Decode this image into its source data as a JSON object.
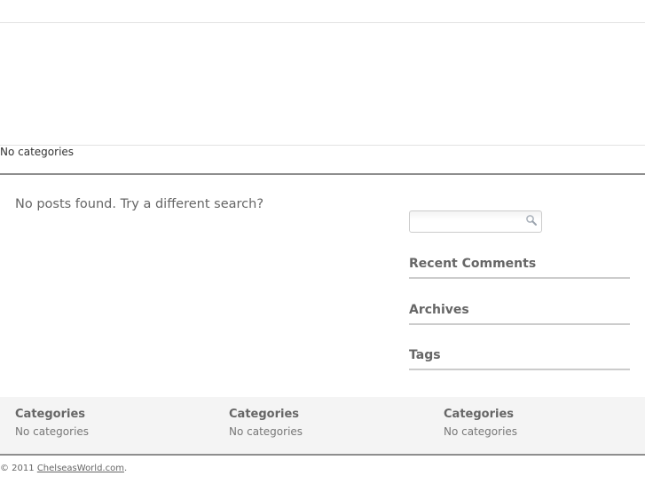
{
  "nav": {
    "text": "No categories"
  },
  "main": {
    "no_posts_message": "No posts found. Try a different search?"
  },
  "sidebar": {
    "search_placeholder": "",
    "widgets": [
      {
        "title": "Recent Comments"
      },
      {
        "title": "Archives"
      },
      {
        "title": "Tags"
      }
    ]
  },
  "footer_widgets": [
    {
      "title": "Categories",
      "text": "No categories"
    },
    {
      "title": "Categories",
      "text": "No categories"
    },
    {
      "title": "Categories",
      "text": "No categories"
    }
  ],
  "copyright": {
    "prefix": "© 2011 ",
    "link_text": "ChelseasWorld.com",
    "suffix": "."
  },
  "colors": {
    "rule_dark": "#8e8e8e",
    "rule_light": "#e2e2e2",
    "footer_bg": "#f4f4f4"
  },
  "icons": {
    "search": "magnifier-icon"
  }
}
